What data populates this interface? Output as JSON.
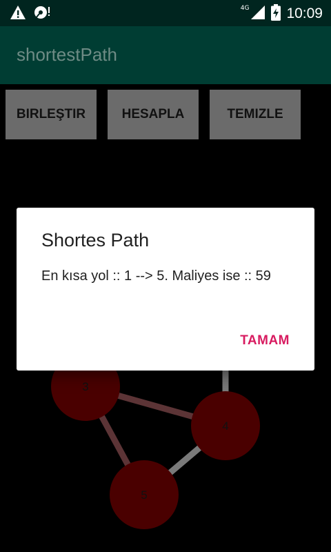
{
  "status_bar": {
    "network_label": "4G",
    "time": "10:09",
    "icons": [
      "warning-icon",
      "sd-card-icon",
      "signal-icon",
      "battery-charging-icon"
    ]
  },
  "app": {
    "title": "shortestPath"
  },
  "toolbar": {
    "merge_label": "BIRLEŞTIR",
    "calculate_label": "HESAPLA",
    "clear_label": "TEMIZLE"
  },
  "graph": {
    "nodes": [
      "3",
      "4",
      "5"
    ],
    "colors": {
      "node": "#4a0000",
      "edge_highlight": "#5c3436",
      "edge_normal": "#7a7a7a"
    }
  },
  "dialog": {
    "title": "Shortes Path",
    "message": "En kısa yol :: 1 --> 5. Maliyes ise :: 59",
    "ok_label": "TAMAM"
  }
}
